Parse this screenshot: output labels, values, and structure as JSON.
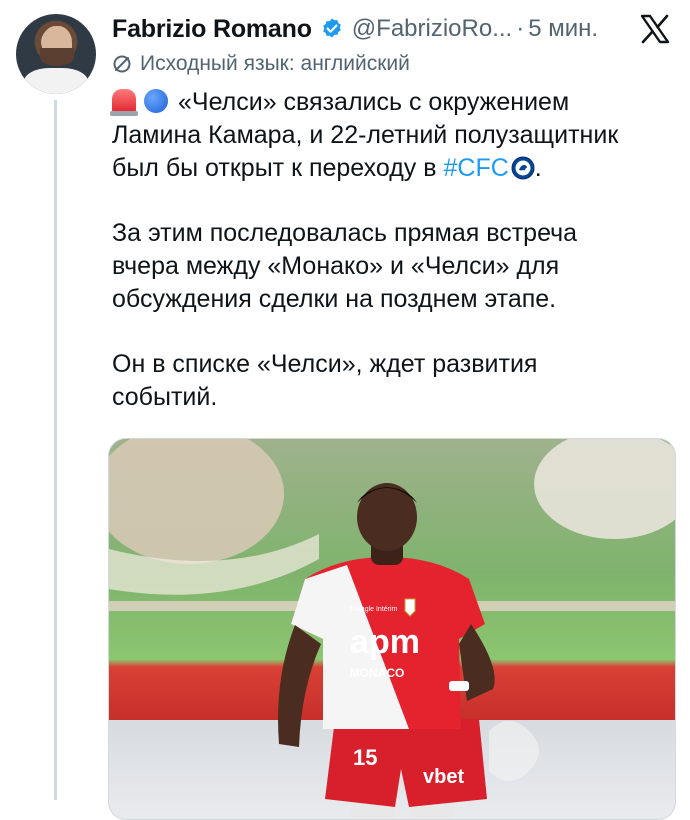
{
  "author": {
    "name": "Fabrizio Romano",
    "handle": "@FabrizioRo...",
    "separator": "·",
    "time": "5 мин."
  },
  "translation": {
    "note": "Исходный язык: английский"
  },
  "tweet": {
    "line1_text": "«Челси» связались с окружением",
    "line2_text": "Ламина Камара, и 22-летний полузащитник",
    "line3_prefix": "был бы открыт к переходу в ",
    "hashtag": "#CFC",
    "line3_suffix": ".",
    "para2_line1": "За этим последовалась прямая встреча",
    "para2_line2": "вчера между «Монако» и «Челси» для",
    "para2_line3": "обсуждения сделки на позднем этапе.",
    "para3_line1": "Он в списке «Челси», ждет развития",
    "para3_line2": "событий."
  },
  "media": {
    "shirt_sponsor": "apm",
    "shirt_sponsor_sub": "MONACO",
    "shorts_sponsor": "vbet",
    "shirt_number": "15",
    "kit_brand": "Triangle Intérim"
  },
  "colors": {
    "accent": "#1d9bf0",
    "secondary_text": "#536471",
    "primary_text": "#0f1419"
  },
  "icons": {
    "verified": "verified-badge-icon",
    "close": "x-logo-icon",
    "translate": "translate-icon"
  }
}
